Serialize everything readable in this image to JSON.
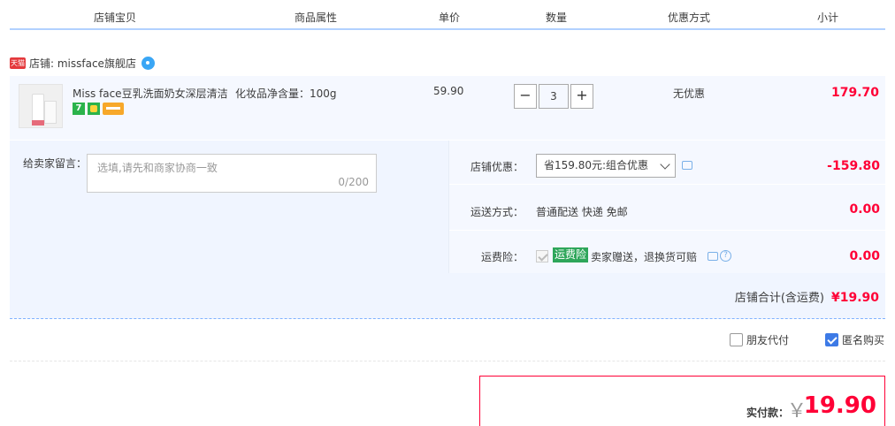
{
  "header": {
    "columns": [
      "店铺宝贝",
      "商品属性",
      "单价",
      "数量",
      "优惠方式",
      "小计"
    ]
  },
  "shop": {
    "tmall_badge": "天猫",
    "label": "店铺: missface旗舰店"
  },
  "item": {
    "title": "Miss face豆乳洗面奶女深层清洁",
    "attr": "化妆品净含量：100g",
    "price": "59.90",
    "quantity": "3",
    "minus_label": "−",
    "plus_label": "+",
    "promotion": "无优惠",
    "subtotal": "179.70"
  },
  "message": {
    "label": "给卖家留言：",
    "placeholder": "选填,请先和商家协商一致",
    "counter": "0/200"
  },
  "discount": {
    "label": "店铺优惠：",
    "selected": "省159.80元:组合优惠",
    "amount": "-159.80"
  },
  "shipping": {
    "label": "运送方式：",
    "value": "普通配送 快递 免邮",
    "amount": "0.00"
  },
  "insurance": {
    "label": "运费险：",
    "tag": "运费险",
    "desc": "卖家赠送，退换货可赔",
    "amount": "0.00"
  },
  "shop_total": {
    "label": "店铺合计(含运费)",
    "amount": "¥19.90"
  },
  "options": {
    "friend_pay": "朋友代付",
    "friend_pay_checked": false,
    "anonymous": "匿名购买",
    "anonymous_checked": true
  },
  "payment": {
    "label": "实付款：",
    "currency": "￥",
    "amount": "19.90"
  },
  "colors": {
    "accent_red": "#ff0036",
    "header_border": "#b2d1ff",
    "panel_bg": "#f0f5ff"
  }
}
